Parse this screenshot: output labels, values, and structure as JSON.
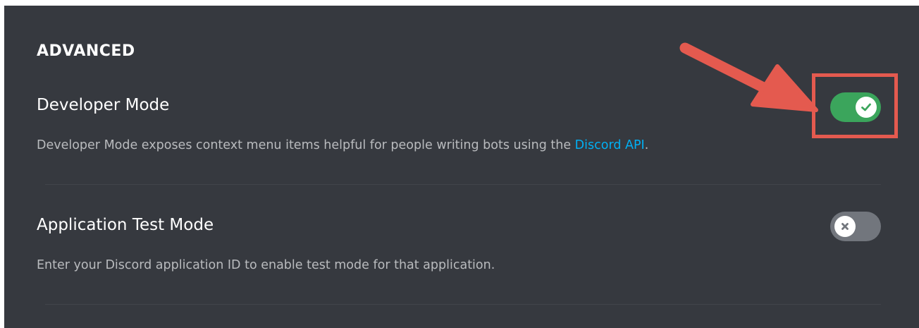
{
  "section": {
    "title": "ADVANCED"
  },
  "settings": [
    {
      "title": "Developer Mode",
      "description_prefix": "Developer Mode exposes context menu items helpful for people writing bots using the ",
      "description_link": "Discord API",
      "description_suffix": ".",
      "enabled": true
    },
    {
      "title": "Application Test Mode",
      "description": "Enter your Discord application ID to enable test mode for that application.",
      "enabled": false
    }
  ],
  "colors": {
    "background": "#36393f",
    "toggle_on": "#3ba55c",
    "toggle_off": "#72767d",
    "link": "#00b0f4",
    "annotation": "#e45a4f"
  },
  "icons": {
    "toggle_on_knob": "checkmark-icon",
    "toggle_off_knob": "x-icon",
    "annotation_arrow": "arrow-icon"
  }
}
